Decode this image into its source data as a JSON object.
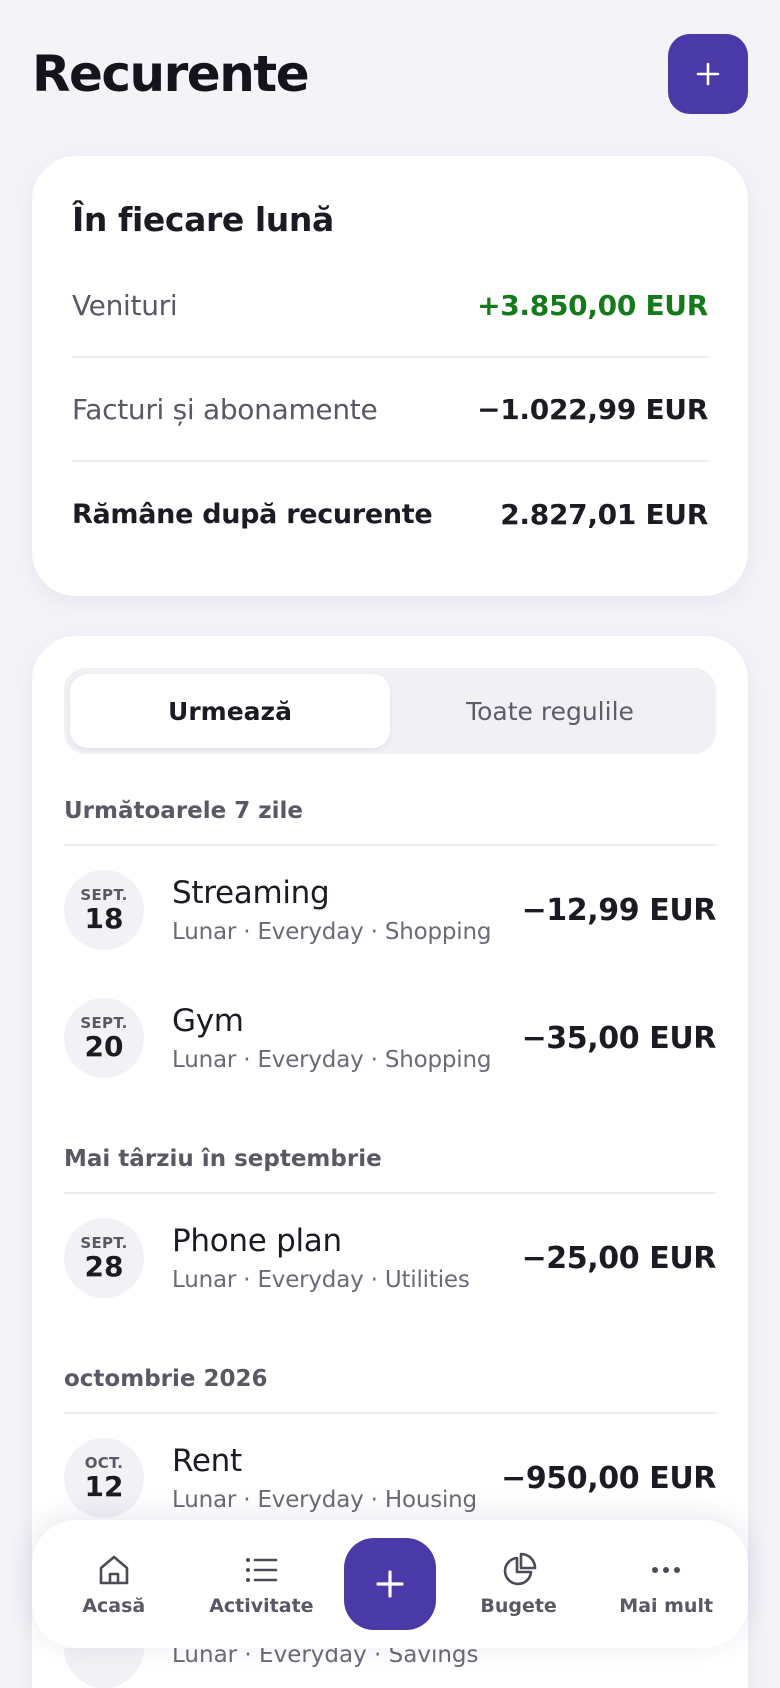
{
  "header": {
    "title": "Recurente"
  },
  "summary": {
    "title": "În fiecare lună",
    "rows": [
      {
        "label": "Venituri",
        "value": "+3.850,00 EUR"
      },
      {
        "label": "Facturi și abonamente",
        "value": "−1.022,99 EUR"
      },
      {
        "label": "Rămâne după recurente",
        "value": "2.827,01 EUR"
      }
    ]
  },
  "tabs": [
    {
      "label": "Urmează",
      "active": true
    },
    {
      "label": "Toate regulile",
      "active": false
    }
  ],
  "sections": [
    {
      "title": "Următoarele 7 zile",
      "items": [
        {
          "month": "SEPT.",
          "day": "18",
          "name": "Streaming",
          "meta": "Lunar · Everyday · Shopping",
          "amount": "−12,99 EUR"
        },
        {
          "month": "SEPT.",
          "day": "20",
          "name": "Gym",
          "meta": "Lunar · Everyday · Shopping",
          "amount": "−35,00 EUR"
        }
      ]
    },
    {
      "title": "Mai târziu în septembrie",
      "items": [
        {
          "month": "SEPT.",
          "day": "28",
          "name": "Phone plan",
          "meta": "Lunar · Everyday · Utilities",
          "amount": "−25,00 EUR"
        }
      ]
    },
    {
      "title": "octombrie 2026",
      "items": [
        {
          "month": "OCT.",
          "day": "12",
          "name": "Rent",
          "meta": "Lunar · Everyday · Housing",
          "amount": "−950,00 EUR"
        }
      ]
    }
  ],
  "peek": {
    "meta": "Lunar · Everyday · Savings"
  },
  "nav": {
    "items": [
      {
        "label": "Acasă",
        "icon": "home-icon"
      },
      {
        "label": "Activitate",
        "icon": "list-icon"
      },
      {
        "label": "Bugete",
        "icon": "pie-chart-icon"
      },
      {
        "label": "Mai mult",
        "icon": "more-icon"
      }
    ]
  },
  "colors": {
    "accent": "#4a3aa8",
    "positive": "#157a1a",
    "background": "#f3f3f8"
  }
}
